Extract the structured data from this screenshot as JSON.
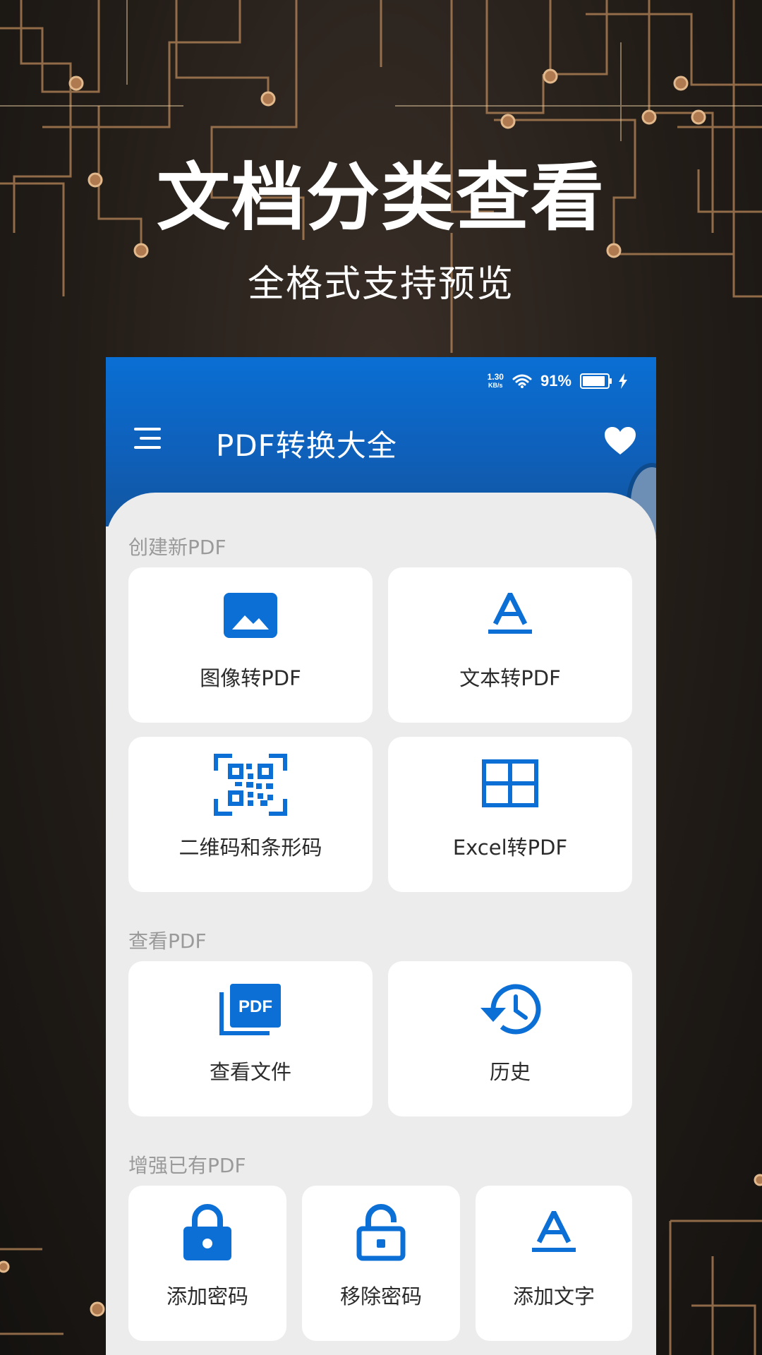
{
  "promo": {
    "headline": "文档分类查看",
    "subline": "全格式支持预览"
  },
  "status_bar": {
    "net_speed_value": "1.30",
    "net_speed_unit": "KB/s",
    "battery_text": "91%",
    "battery_level": 0.91
  },
  "app_bar": {
    "title": "PDF转换大全",
    "menu_icon": "menu-icon",
    "favorite_icon": "heart-icon"
  },
  "sections": {
    "create": {
      "title": "创建新PDF",
      "items": [
        {
          "label": "图像转PDF",
          "icon": "image-icon"
        },
        {
          "label": "文本转PDF",
          "icon": "text-format-icon"
        },
        {
          "label": "二维码和条形码",
          "icon": "qr-code-scan-icon"
        },
        {
          "label": "Excel转PDF",
          "icon": "grid-table-icon"
        }
      ]
    },
    "view": {
      "title": "查看PDF",
      "items": [
        {
          "label": "查看文件",
          "icon": "pdf-file-icon"
        },
        {
          "label": "历史",
          "icon": "history-icon"
        }
      ]
    },
    "enhance": {
      "title": "增强已有PDF",
      "items": [
        {
          "label": "添加密码",
          "icon": "lock-icon"
        },
        {
          "label": "移除密码",
          "icon": "unlock-icon"
        },
        {
          "label": "添加文字",
          "icon": "text-format-icon"
        }
      ]
    }
  },
  "colors": {
    "accent": "#0b6fd6",
    "header_top": "#0a6fd4",
    "header_bottom": "#12559f",
    "content_bg": "#ececec",
    "card_bg": "#ffffff",
    "section_title": "#9a9a9a",
    "circuit": "#c79a6a"
  },
  "pdf_badge_text": "PDF"
}
